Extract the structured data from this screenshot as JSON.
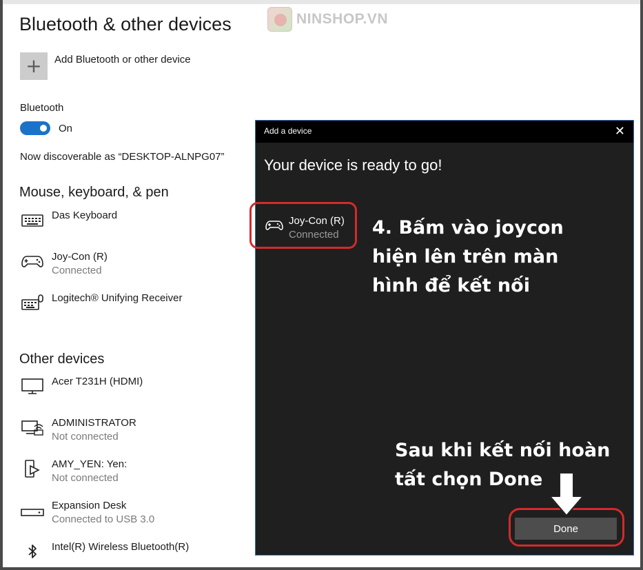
{
  "settings": {
    "title": "Bluetooth & other devices",
    "add_device_label": "Add Bluetooth or other device",
    "bluetooth_label": "Bluetooth",
    "bluetooth_state": "On",
    "discoverable_text": "Now discoverable as “DESKTOP-ALNPG07”",
    "sections": {
      "mouse": "Mouse, keyboard, & pen",
      "other": "Other devices"
    },
    "mouse_devices": [
      {
        "name": "Das Keyboard",
        "status": "",
        "icon": "keyboard-icon"
      },
      {
        "name": "Joy-Con (R)",
        "status": "Connected",
        "icon": "gamepad-icon"
      },
      {
        "name": "Logitech® Unifying Receiver",
        "status": "",
        "icon": "keyboard-mouse-icon"
      }
    ],
    "other_devices": [
      {
        "name": "Acer T231H (HDMI)",
        "status": "",
        "icon": "monitor-icon"
      },
      {
        "name": "ADMINISTRATOR",
        "status": "Not connected",
        "icon": "network-pc-icon"
      },
      {
        "name": "AMY_YEN: Yen:",
        "status": "Not connected",
        "icon": "media-device-icon"
      },
      {
        "name": "Expansion Desk",
        "status": "Connected to USB 3.0",
        "icon": "drive-icon"
      },
      {
        "name": "Intel(R) Wireless Bluetooth(R)",
        "status": "",
        "icon": "bluetooth-icon"
      }
    ]
  },
  "watermark": {
    "text": "NINSHOP.VN"
  },
  "dialog": {
    "title": "Add a device",
    "heading": "Your device is ready to go!",
    "device": {
      "name": "Joy-Con (R)",
      "status": "Connected"
    },
    "done_label": "Done"
  },
  "annotations": {
    "step4_lines": [
      "4. Bấm vào joycon",
      "hiện lên trên màn",
      "hình để kết nối"
    ],
    "done_note_lines": [
      "Sau khi kết nối hoàn",
      "tất chọn Done"
    ]
  },
  "colors": {
    "accent": "#1a73c8",
    "dialog_bg": "#1f1f1f",
    "highlight_red": "#d42a2a"
  }
}
